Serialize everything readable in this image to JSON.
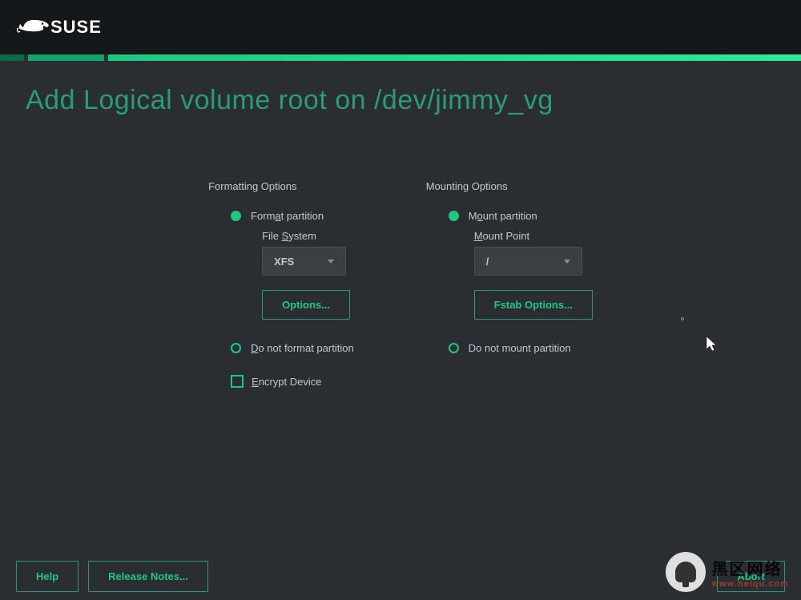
{
  "brand": "SUSE",
  "title": "Add Logical volume root on /dev/jimmy_vg",
  "formatting": {
    "section": "Formatting Options",
    "format_prefix": "Form",
    "format_u": "a",
    "format_suffix": "t partition",
    "fs_prefix": "File ",
    "fs_u": "S",
    "fs_suffix": "ystem",
    "fs_value": "XFS",
    "options_button": "Options...",
    "noformat_u": "D",
    "noformat_suffix": "o not format partition",
    "encrypt_u": "E",
    "encrypt_suffix": "ncrypt Device"
  },
  "mounting": {
    "section": "Mounting Options",
    "mount_prefix": "M",
    "mount_u": "o",
    "mount_suffix": "unt partition",
    "mp_u": "M",
    "mp_suffix": "ount Point",
    "mp_value": "/",
    "fstab_button": "Fstab Options...",
    "nomount_label": "Do not mount partition"
  },
  "footer": {
    "help": "Help",
    "release_notes": "Release Notes...",
    "abort": "Abort"
  },
  "watermark": {
    "line1": "黑区网络",
    "line2": "www.heiqu.com"
  }
}
